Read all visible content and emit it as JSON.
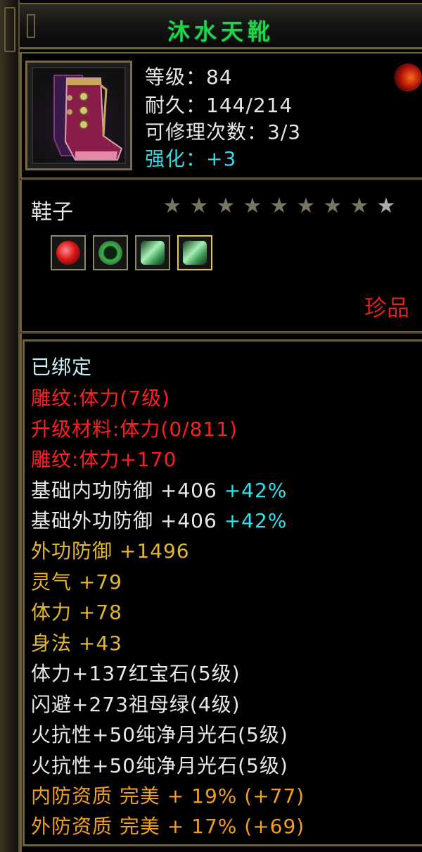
{
  "title": "沐水天靴",
  "item": {
    "icon": "boots-icon",
    "level_line": "等级：84",
    "durability_line": "耐久：144/214",
    "repair_line": "可修理次数：3/3",
    "enhance_line": "强化：+3",
    "badge_icon": "fire-emblem-icon",
    "type": "鞋子",
    "stars_total": 9,
    "stars_lit": 8,
    "gems": [
      {
        "icon": "ruby-gem-icon",
        "color": "#d81818"
      },
      {
        "icon": "emerald-gem-icon",
        "color": "#2f9a3a"
      },
      {
        "icon": "moonstone-gem-icon",
        "color": "#6fd38a"
      },
      {
        "icon": "moonstone-gem-icon",
        "color": "#6fd38a"
      }
    ],
    "rarity": "珍品"
  },
  "attributes": {
    "bound": "已绑定",
    "engrave": "雕纹:体力(7级)",
    "upgrade_material": "升级材料:体力(0/811)",
    "engrave_bonus": "雕纹:体力+170",
    "inner_def_base": "基础内功防御 +406",
    "inner_def_pct": "+42%",
    "outer_def_base": "基础外功防御 +406",
    "outer_def_pct": "+42%",
    "outer_def": "外功防御 +1496",
    "spirit": "灵气 +79",
    "stamina": "体力 +78",
    "agility": "身法 +43",
    "gem1": "体力+137红宝石(5级)",
    "gem2": "闪避+273祖母绿(4级)",
    "gem3": "火抗性+50纯净月光石(5级)",
    "gem4": "火抗性+50纯净月光石(5级)",
    "inner_quality": "内防资质 完美 + 19% (+77)",
    "outer_quality": "外防资质 完美 + 17% (+69)"
  },
  "colors": {
    "title": "#21d24a",
    "border": "#6e613e",
    "rarity": "#e0201e"
  }
}
